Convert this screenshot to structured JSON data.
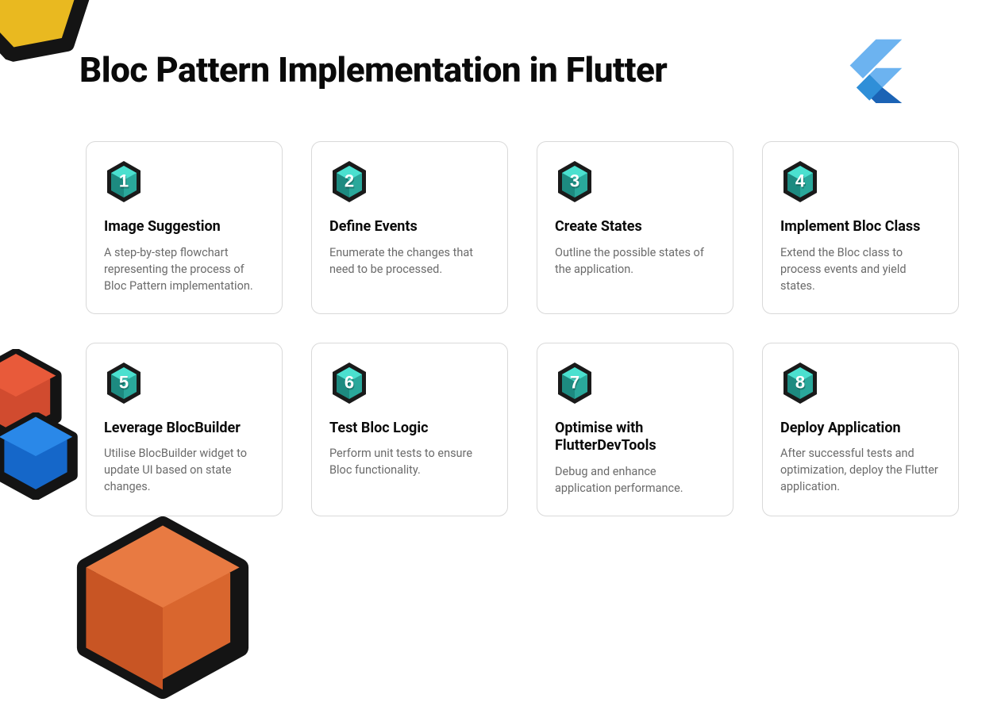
{
  "title": "Bloc Pattern Implementation in Flutter",
  "cards": [
    {
      "num": "1",
      "title": "Image Suggestion",
      "desc": "A step-by-step flowchart representing the process of Bloc Pattern implementation."
    },
    {
      "num": "2",
      "title": "Define Events",
      "desc": "Enumerate the changes that need to be processed."
    },
    {
      "num": "3",
      "title": "Create States",
      "desc": "Outline the possible states of the application."
    },
    {
      "num": "4",
      "title": "Implement Bloc Class",
      "desc": "Extend the Bloc class to process events and yield states."
    },
    {
      "num": "5",
      "title": "Leverage BlocBuilder",
      "desc": "Utilise BlocBuilder widget to update UI based on state changes."
    },
    {
      "num": "6",
      "title": "Test Bloc Logic",
      "desc": "Perform unit tests to ensure Bloc functionality."
    },
    {
      "num": "7",
      "title": "Optimise with FlutterDevTools",
      "desc": "Debug and enhance application performance."
    },
    {
      "num": "8",
      "title": "Deploy Application",
      "desc": "After successful tests and optimization, deploy the Flutter application."
    }
  ],
  "colors": {
    "hex_outer": "#1a1a1a",
    "hex_top": "#3bd4c4",
    "hex_left": "#2aa89b",
    "hex_right": "#1d8a80"
  }
}
